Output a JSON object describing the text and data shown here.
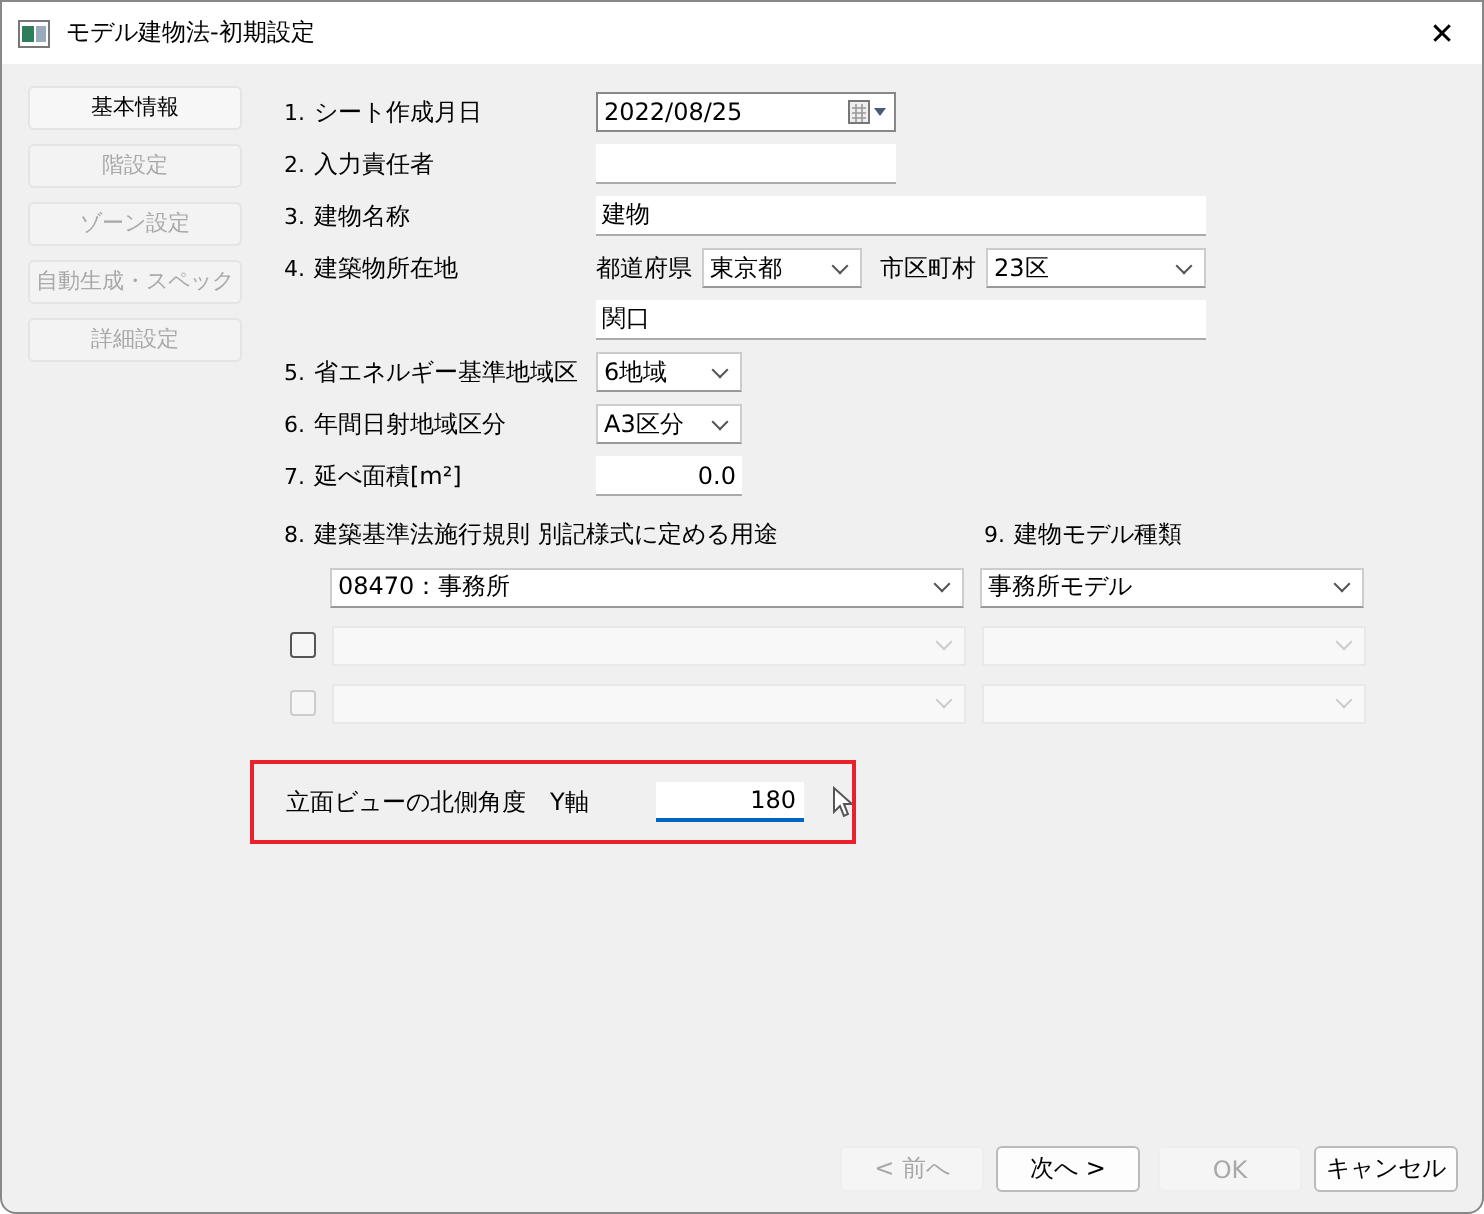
{
  "window": {
    "title": "モデル建物法-初期設定",
    "close": "✕"
  },
  "sidebar": [
    {
      "label": "基本情報",
      "disabled": false
    },
    {
      "label": "階設定",
      "disabled": true
    },
    {
      "label": "ゾーン設定",
      "disabled": true
    },
    {
      "label": "自動生成・スペック",
      "disabled": true
    },
    {
      "label": "詳細設定",
      "disabled": true
    }
  ],
  "fields": [
    {
      "number": "1.",
      "label": "シート作成月日",
      "kind": "date",
      "value": "2022/08/25"
    },
    {
      "number": "2.",
      "label": "入力責任者",
      "kind": "text"
    },
    {
      "number": "3.",
      "label": "建物名称",
      "kind": "wide",
      "value": "建物"
    },
    {
      "number": "4.",
      "label": "建築物所在地",
      "kind": "location",
      "prefecture_label": "都道府県",
      "prefecture": "東京都",
      "city_label": "市区町村",
      "city": "23区",
      "address": "関口"
    },
    {
      "number": "5.",
      "label": "省エネルギー基準地域区",
      "kind": "select",
      "value": "6地域"
    },
    {
      "number": "6.",
      "label": "年間日射地域区分",
      "kind": "select",
      "value": "A3区分"
    },
    {
      "number": "7.",
      "label": "延べ面積[m²]",
      "kind": "number",
      "value": "0.0"
    }
  ],
  "usage": {
    "number": "8.",
    "label": "建築基準法施行規則 別記様式に定める用途",
    "model_number": "9.",
    "model_label": "建物モデル種類",
    "rows": [
      {
        "kind": "primary",
        "use": "08470：事務所",
        "model": "事務所モデル"
      },
      {
        "kind": "extra",
        "checked": false,
        "disabled": false
      },
      {
        "kind": "extra",
        "checked": false,
        "disabled": true
      }
    ]
  },
  "north": {
    "label": "立面ビューの北側角度",
    "axis": "Y軸",
    "value": "180",
    "highlighted": true
  },
  "buttons": [
    {
      "label": "< 前へ",
      "disabled": true
    },
    {
      "label": "次へ >",
      "disabled": false
    },
    {
      "label": "OK",
      "disabled": true
    },
    {
      "label": "キャンセル",
      "disabled": false
    }
  ]
}
